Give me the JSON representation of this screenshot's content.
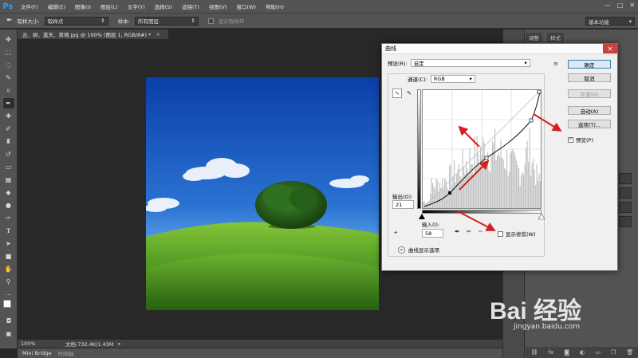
{
  "app": {
    "logo": "Ps",
    "menu": [
      "文件(F)",
      "编辑(E)",
      "图像(I)",
      "图层(L)",
      "文字(Y)",
      "选择(S)",
      "滤镜(T)",
      "视图(V)",
      "窗口(W)",
      "帮助(H)"
    ],
    "window_controls": [
      "—",
      "□",
      "✕"
    ]
  },
  "options_bar": {
    "sample_size_label": "取样大小:",
    "sample_size_value": "取样点",
    "sample_label": "样本:",
    "sample_value": "所有图层",
    "show_ring_label": "显示取样环",
    "workspace": "基本功能"
  },
  "document": {
    "tab_title": "云、树、蓝天、草地.jpg @ 100% (图层 1, RGB/8#) *",
    "zoom": "100%",
    "doc_info": "文档:732.4K/1.43M"
  },
  "bottom_tabs": [
    "Mini Bridge",
    "时间轴"
  ],
  "right_panel": {
    "tabs": [
      "调整",
      "样式"
    ]
  },
  "curves_dialog": {
    "title": "曲线",
    "preset_label": "预设(R):",
    "preset_value": "自定",
    "channel_label": "通道(C):",
    "channel_value": "RGB",
    "output_label": "输出(O):",
    "output_value": "21",
    "input_label": "输入(I):",
    "input_value": "58",
    "show_clipping_label": "显示修剪(W)",
    "display_options_label": "曲线显示选项",
    "buttons": {
      "ok": "确定",
      "cancel": "取消",
      "smooth": "平滑(M)",
      "auto": "自动(A)",
      "options": "选项(T)..."
    },
    "preview_label": "预览(P)",
    "preview_checked": true
  },
  "watermark": {
    "logo": "Bai 经验",
    "url": "jingyan.baidu.com"
  },
  "colors": {
    "chrome": "#535353",
    "workspace": "#282828",
    "dialog_bg": "#f0f0f0",
    "arrow_red": "#d42020",
    "sky_blue": "#1f5fc8",
    "grass_green": "#5aa327"
  }
}
